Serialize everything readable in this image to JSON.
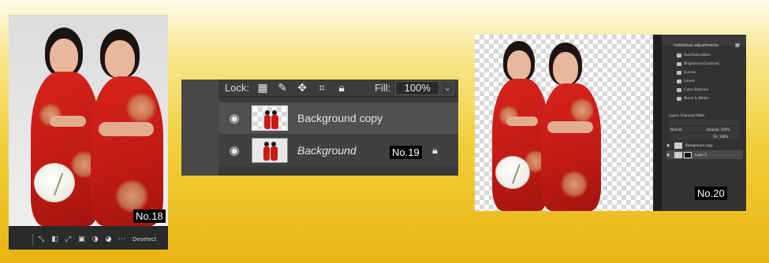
{
  "labels": {
    "tag18": "No.18",
    "tag19": "No.19",
    "tag20": "No.20"
  },
  "panel18": {
    "toolbar_action": "Deselect",
    "toolbar_icons": [
      "drag-handle-icon",
      "select-subject-icon",
      "mask-icon",
      "transform-icon",
      "crop-icon",
      "invert-icon",
      "brush-icon",
      "more-icon"
    ]
  },
  "panel19": {
    "lock_label": "Lock:",
    "fill_label": "Fill:",
    "fill_value": "100%",
    "layers": [
      {
        "name": "Background copy",
        "visible": true,
        "selected": true
      },
      {
        "name": "Background",
        "visible": true,
        "locked": true
      }
    ]
  },
  "panel20": {
    "adjustments_title": "Individual adjustments",
    "adjustments": [
      "Hue/Saturation",
      "Brightness/Contrast",
      "Curves",
      "Levels",
      "Color Balance",
      "Black & White"
    ],
    "tabs": "Layers   Channels   Paths",
    "blend": "Normal",
    "opacity": "Opacity: 100%",
    "fill": "Fill: 100%",
    "layers": [
      "Background copy",
      "Layer 0"
    ]
  },
  "colors": {
    "background_top": "#fdfbe6",
    "background_bottom": "#e9b314",
    "dress_red": "#d7241c",
    "photoshop_panel": "#3a3a3a"
  }
}
